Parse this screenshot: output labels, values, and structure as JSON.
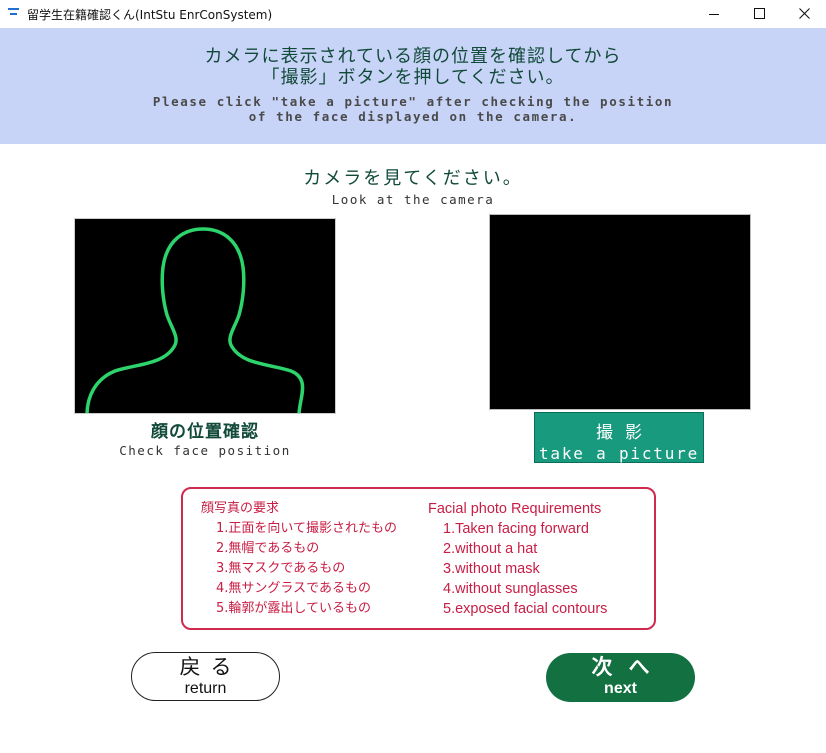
{
  "window": {
    "title": "留学生在籍確認くん(IntStu EnrConSystem)"
  },
  "banner": {
    "instruction_jp": "カメラに表示されている顔の位置を確認してから\n「撮影」ボタンを押してください。",
    "instruction_en": "Please click \"take a picture\" after checking the position\nof the face displayed on the camera."
  },
  "look": {
    "jp": "カメラを見てください。",
    "en": "Look at the camera"
  },
  "guide": {
    "label_jp": "顔の位置確認",
    "label_en": "Check face position",
    "outline_color": "#2dd46b"
  },
  "capture_button": {
    "label_jp": "撮影",
    "label_en": "take a picture"
  },
  "requirements": {
    "title_jp": "顔写真の要求",
    "title_en": "Facial photo Requirements",
    "items_jp": [
      "1.正面を向いて撮影されたもの",
      "2.無帽であるもの",
      "3.無マスクであるもの",
      "4.無サングラスであるもの",
      "5.輪郭が露出しているもの"
    ],
    "items_en": [
      "1.Taken facing forward",
      "2.without a hat",
      "3.without mask",
      "4.without sunglasses",
      "5.exposed facial contours"
    ]
  },
  "nav": {
    "return_jp": "戻る",
    "return_en": "return",
    "next_jp": "次へ",
    "next_en": "next"
  },
  "colors": {
    "banner_bg": "#c8d4f7",
    "accent_green": "#179a7e",
    "next_green": "#137041",
    "requirements_red": "#c81e45"
  }
}
